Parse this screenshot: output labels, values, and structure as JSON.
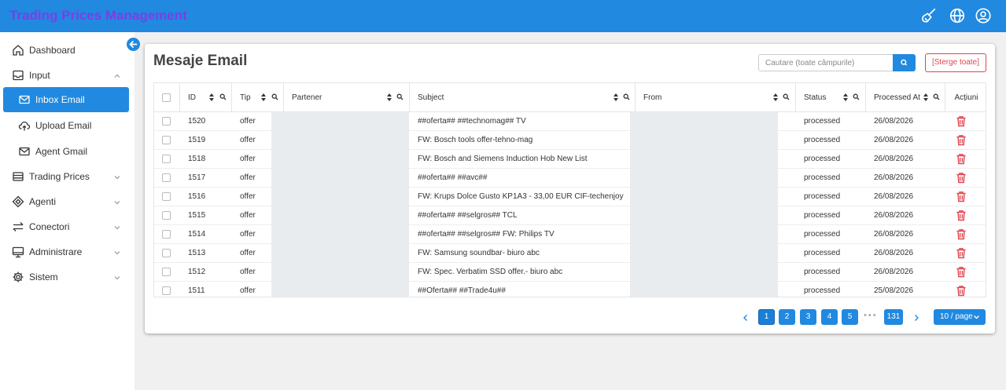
{
  "header": {
    "app_title": "Trading Prices Management",
    "icons": [
      "broom-icon",
      "globe-icon",
      "user-circle-icon"
    ]
  },
  "sidebar": {
    "items": [
      {
        "label": "Dashboard",
        "icon": "home-icon"
      },
      {
        "label": "Input",
        "icon": "inbox-tray-icon",
        "expanded": true
      },
      {
        "label": "Inbox Email",
        "icon": "mail-icon",
        "active": true
      },
      {
        "label": "Upload Email",
        "icon": "cloud-upload-icon"
      },
      {
        "label": "Agent Gmail",
        "icon": "mail-icon"
      },
      {
        "label": "Trading Prices",
        "icon": "table-icon"
      },
      {
        "label": "Agenti",
        "icon": "node-icon"
      },
      {
        "label": "Conectori",
        "icon": "swap-icon"
      },
      {
        "label": "Administrare",
        "icon": "monitor-icon"
      },
      {
        "label": "Sistem",
        "icon": "gear-icon"
      }
    ]
  },
  "main": {
    "title": "Mesaje Email",
    "search_placeholder": "Cautare (toate câmpurile)",
    "clear_label": "[Sterge toate]",
    "columns": [
      "ID",
      "Tip",
      "Partener",
      "Subject",
      "From",
      "Status",
      "Processed At",
      "Acțiuni"
    ],
    "rows": [
      {
        "id": "1520",
        "tip": "offer",
        "subject": "##oferta## ##technomag## TV",
        "status": "processed",
        "processed_at": "26/08/2026"
      },
      {
        "id": "1519",
        "tip": "offer",
        "subject": "FW: Bosch tools offer-tehno-mag",
        "status": "processed",
        "processed_at": "26/08/2026"
      },
      {
        "id": "1518",
        "tip": "offer",
        "subject": "FW: Bosch and Siemens Induction Hob New List",
        "status": "processed",
        "processed_at": "26/08/2026"
      },
      {
        "id": "1517",
        "tip": "offer",
        "subject": "##oferta## ##avc##",
        "status": "processed",
        "processed_at": "26/08/2026"
      },
      {
        "id": "1516",
        "tip": "offer",
        "subject": "FW: Krups Dolce Gusto KP1A3 - 33,00 EUR CIF-techenjoy",
        "status": "processed",
        "processed_at": "26/08/2026"
      },
      {
        "id": "1515",
        "tip": "offer",
        "subject": "##oferta## ##selgros## TCL",
        "status": "processed",
        "processed_at": "26/08/2026"
      },
      {
        "id": "1514",
        "tip": "offer",
        "subject": "##oferta## ##selgros## FW: Philips TV",
        "status": "processed",
        "processed_at": "26/08/2026"
      },
      {
        "id": "1513",
        "tip": "offer",
        "subject": "FW: Samsung soundbar- biuro abc",
        "status": "processed",
        "processed_at": "26/08/2026"
      },
      {
        "id": "1512",
        "tip": "offer",
        "subject": "FW: Spec. Verbatim SSD offer.- biuro abc",
        "status": "processed",
        "processed_at": "26/08/2026"
      },
      {
        "id": "1511",
        "tip": "offer",
        "subject": "##Oferta## ##Trade4u##",
        "status": "processed",
        "processed_at": "25/08/2026"
      }
    ]
  },
  "pagination": {
    "pages": [
      "1",
      "2",
      "3",
      "4",
      "5"
    ],
    "current": "1",
    "ellipsis": "•••",
    "last_page": "131",
    "page_size": "10 / page"
  },
  "colors": {
    "accent": "#2189e0",
    "title_text": "#7b3fe4",
    "delete": "#e0454f",
    "redaction": "#e9ecef"
  }
}
